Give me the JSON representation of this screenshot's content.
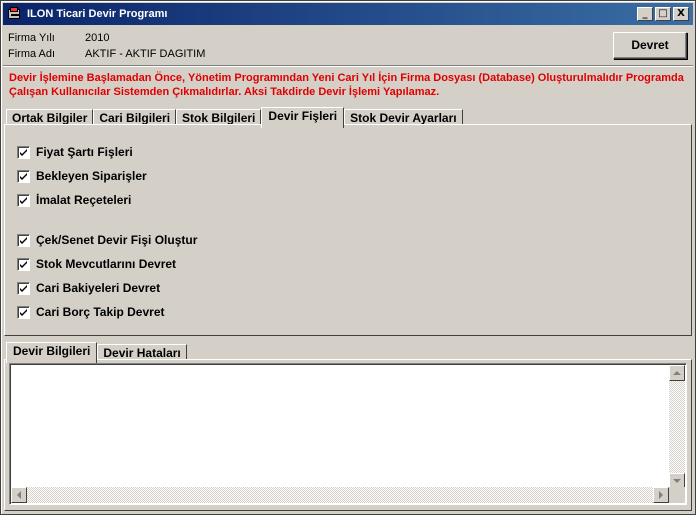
{
  "window": {
    "title": "ILON Ticari Devir Programı",
    "controls": {
      "minimize": "_",
      "maximize": "□",
      "close": "X"
    }
  },
  "info": {
    "year_label": "Firma Yılı",
    "year_value": "2010",
    "name_label": "Firma Adı",
    "name_value": "AKTIF - AKTIF DAGITIM"
  },
  "devret_button": "Devret",
  "warning": "Devir İşlemine Başlamadan Önce, Yönetim Programından Yeni Cari Yıl İçin Firma Dosyası (Database) Oluşturulmalıdır Programda Çalışan Kullanıcılar Sistemden Çıkmalıdırlar. Aksi Takdirde Devir İşlemi Yapılamaz.",
  "colors": {
    "warning": "#e00000",
    "titlebar_start": "#0a246a",
    "titlebar_end": "#3a6ea5"
  },
  "main_tabs": [
    {
      "label": "Ortak Bilgiler",
      "active": false
    },
    {
      "label": "Cari Bilgileri",
      "active": false
    },
    {
      "label": "Stok Bilgileri",
      "active": false
    },
    {
      "label": "Devir Fişleri",
      "active": true
    },
    {
      "label": "Stok Devir Ayarları",
      "active": false
    }
  ],
  "checkboxes": [
    {
      "label": "Fiyat Şartı Fişleri",
      "checked": true
    },
    {
      "label": "Bekleyen Siparişler",
      "checked": true
    },
    {
      "label": "İmalat Reçeteleri",
      "checked": true
    },
    {
      "label": "Çek/Senet Devir Fişi Oluştur",
      "checked": true
    },
    {
      "label": "Stok Mevcutlarını Devret",
      "checked": true
    },
    {
      "label": "Cari Bakiyeleri Devret",
      "checked": true
    },
    {
      "label": "Cari Borç Takip Devret",
      "checked": true
    }
  ],
  "bottom_tabs": [
    {
      "label": "Devir Bilgileri",
      "active": true
    },
    {
      "label": "Devir Hataları",
      "active": false
    }
  ],
  "log_text": ""
}
